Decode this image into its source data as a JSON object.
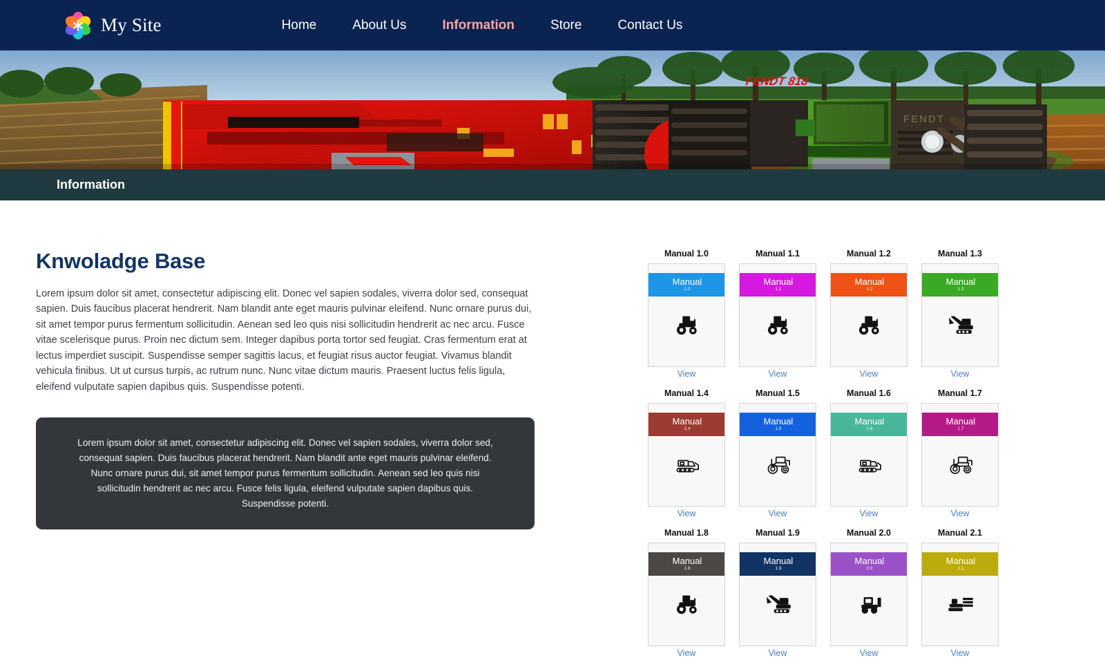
{
  "header": {
    "brand_name": "My Site",
    "logo_icon": "flower-petal-logo",
    "nav": [
      {
        "label": "Home",
        "active": false
      },
      {
        "label": "About Us",
        "active": false
      },
      {
        "label": "Information",
        "active": true
      },
      {
        "label": "Store",
        "active": false
      },
      {
        "label": "Contact Us",
        "active": false
      }
    ],
    "bg_color": "#0a2351",
    "active_color": "#f6a6a0"
  },
  "hero": {
    "alt": "red farm harvester trailer towed by a green FENDT 818 tractor in a ploughed field",
    "vehicle_label": "FENDT 818",
    "brand_label": "FENDT"
  },
  "section_bar": {
    "title": "Information",
    "bg_color": "#1f3a40"
  },
  "knowledge_base": {
    "title": "Knwoladge Base",
    "body": "Lorem ipsum dolor sit amet, consectetur adipiscing elit. Donec vel sapien sodales, viverra dolor sed, consequat sapien. Duis faucibus placerat hendrerit. Nam blandit ante eget mauris pulvinar eleifend. Nunc ornare purus dui, sit amet tempor purus fermentum sollicitudin. Aenean sed leo quis nisi sollicitudin hendrerit ac nec arcu. Fusce vitae scelerisque purus. Proin nec dictum sem. Integer dapibus porta tortor sed feugiat. Cras fermentum erat at lectus imperdiet suscipit. Suspendisse semper sagittis lacus, et feugiat risus auctor feugiat. Vivamus blandit vehicula finibus. Ut ut cursus turpis, ac rutrum nunc. Nunc vitae dictum mauris. Praesent luctus felis ligula, eleifend vulputate sapien dapibus quis. Suspendisse potenti.",
    "callout": "Lorem ipsum dolor sit amet, consectetur adipiscing elit. Donec vel sapien sodales, viverra dolor sed, consequat sapien. Duis faucibus placerat hendrerit. Nam blandit ante eget mauris pulvinar eleifend. Nunc ornare purus dui, sit amet tempor purus fermentum sollicitudin. Aenean sed leo quis nisi sollicitudin hendrerit ac nec arcu. Fusce felis ligula, eleifend vulputate sapien dapibus quis. Suspendisse potenti.",
    "title_color": "#123464",
    "callout_bg": "#33373b"
  },
  "manuals": {
    "band_label": "Manual",
    "view_label": "View",
    "view_color": "#4a7ebb",
    "items": [
      {
        "title": "Manual 1.0",
        "version": "1.0",
        "color": "#1e96e8",
        "icon": "tractor-icon"
      },
      {
        "title": "Manual 1.1",
        "version": "1.1",
        "color": "#d519e0",
        "icon": "tractor-icon"
      },
      {
        "title": "Manual 1.2",
        "version": "1.2",
        "color": "#ef5215",
        "icon": "tractor-icon"
      },
      {
        "title": "Manual 1.3",
        "version": "1.3",
        "color": "#3aaa24",
        "icon": "excavator-icon"
      },
      {
        "title": "Manual 1.4",
        "version": "1.4",
        "color": "#9c3b32",
        "icon": "excavator-outline-icon"
      },
      {
        "title": "Manual 1.5",
        "version": "1.5",
        "color": "#1461e0",
        "icon": "tractor-outline-icon"
      },
      {
        "title": "Manual 1.6",
        "version": "1.6",
        "color": "#49b69c",
        "icon": "excavator-outline-icon"
      },
      {
        "title": "Manual 1.7",
        "version": "1.7",
        "color": "#b51a86",
        "icon": "tractor-outline-icon"
      },
      {
        "title": "Manual 1.8",
        "version": "1.8",
        "color": "#4c4846",
        "icon": "tractor-icon"
      },
      {
        "title": "Manual 1.9",
        "version": "1.9",
        "color": "#123464",
        "icon": "excavator-icon"
      },
      {
        "title": "Manual 2.0",
        "version": "2.0",
        "color": "#9b52c8",
        "icon": "loader-icon"
      },
      {
        "title": "Manual 2.1",
        "version": "2.1",
        "color": "#bbab0d",
        "icon": "bulldozer-icon"
      }
    ]
  }
}
